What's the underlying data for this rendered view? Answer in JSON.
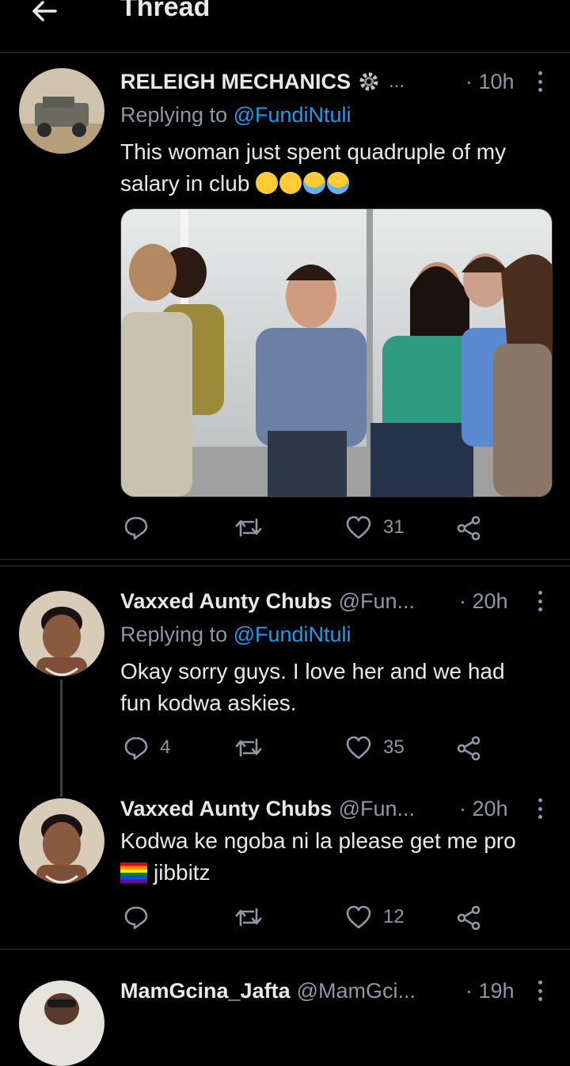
{
  "header": {
    "title": "Thread"
  },
  "tweets": [
    {
      "display_name": "RELEIGH MECHANICS",
      "handle": "...",
      "time": "· 10h",
      "replying_prefix": "Replying to ",
      "replying_to": "@FundiNtuli",
      "text_line1": "This woman just spent quadruple of my",
      "text_line2": "salary in  club",
      "emojis": [
        "grinning-sweat",
        "grinning-sweat",
        "loudly-crying",
        "loudly-crying"
      ],
      "replies": "",
      "retweets": "",
      "likes": "31"
    },
    {
      "display_name": "Vaxxed Aunty Chubs",
      "handle": "@Fun...",
      "time": "· 20h",
      "replying_prefix": "Replying to ",
      "replying_to": "@FundiNtuli",
      "text_line1": "Okay sorry guys. I love her and we had",
      "text_line2": "fun kodwa askies.",
      "replies": "4",
      "retweets": "",
      "likes": "35"
    },
    {
      "display_name": "Vaxxed Aunty Chubs",
      "handle": "@Fun...",
      "time": "· 20h",
      "text_line1": "Kodwa ke ngoba ni la please get me pro",
      "text_line2": "jibbitz",
      "flag_icon": "rainbow-flag",
      "replies": "",
      "retweets": "",
      "likes": "12"
    },
    {
      "display_name": "MamGcina_Jafta",
      "handle": "@MamGci...",
      "time": "· 19h"
    }
  ]
}
